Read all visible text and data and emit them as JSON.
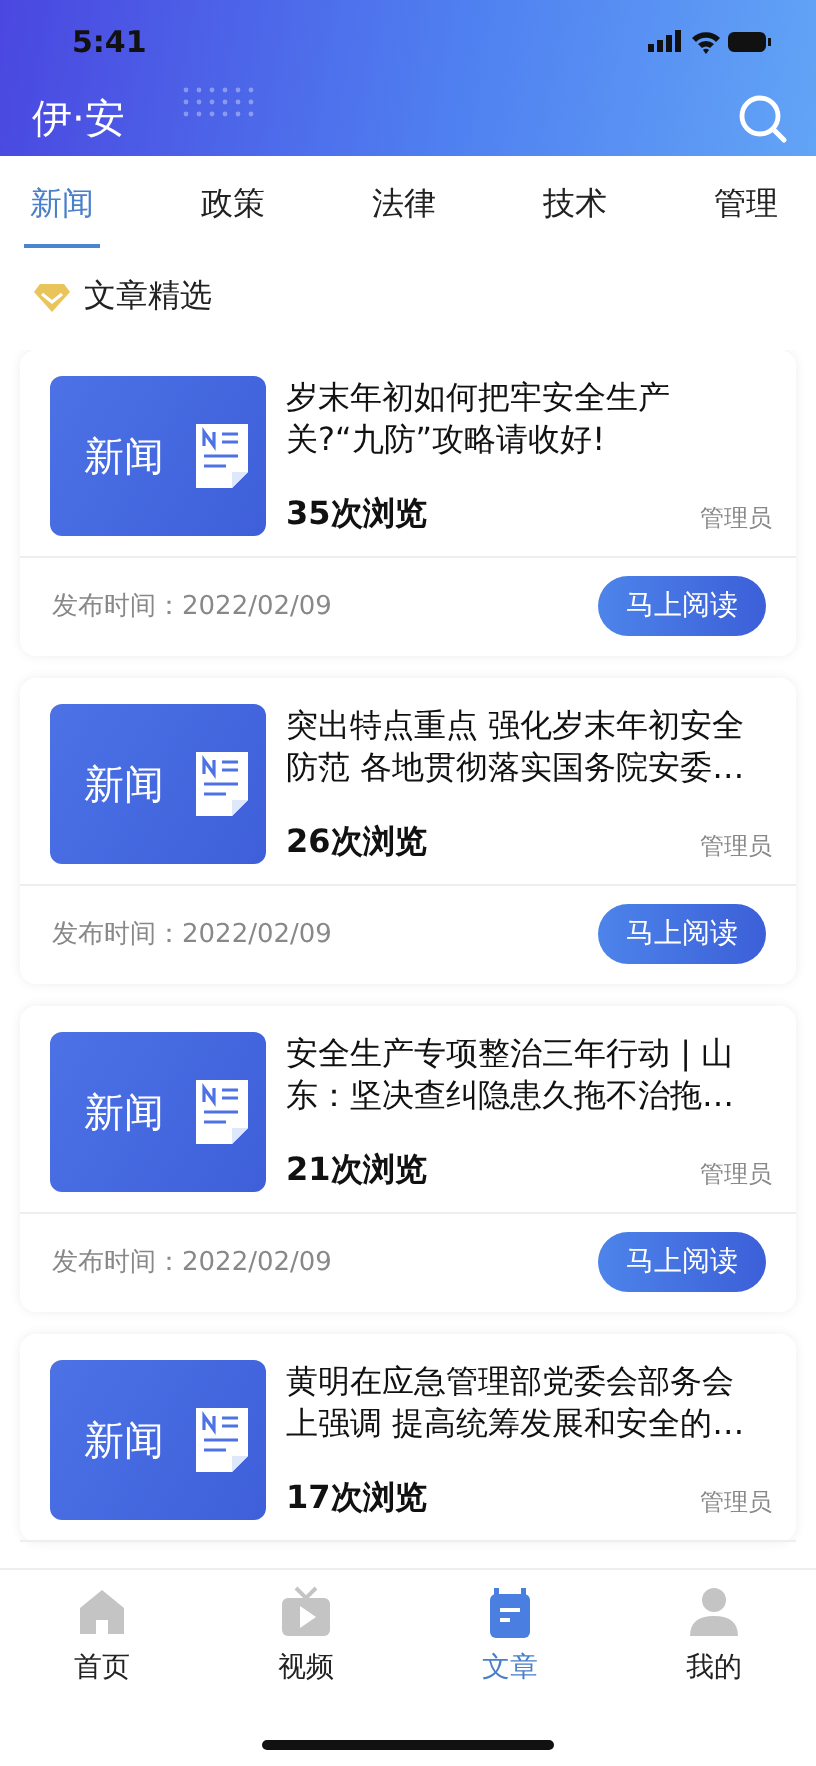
{
  "status_bar": {
    "time": "5:41"
  },
  "header": {
    "title": "伊·安"
  },
  "tabs": [
    {
      "label": "新闻",
      "selected": true
    },
    {
      "label": "政策",
      "selected": false
    },
    {
      "label": "法律",
      "selected": false
    },
    {
      "label": "技术",
      "selected": false
    },
    {
      "label": "管理",
      "selected": false
    }
  ],
  "section": {
    "title": "文章精选"
  },
  "articles": [
    {
      "thumb_label": "新闻",
      "title": "岁末年初如何把牢安全生产关?“九防”攻略请收好!",
      "views": "35次浏览",
      "author": "管理员",
      "date": "发布时间：2022/02/09",
      "button": "马上阅读"
    },
    {
      "thumb_label": "新闻",
      "title": "突出特点重点 强化岁末年初安全防范 各地贯彻落实国务院安委…",
      "views": "26次浏览",
      "author": "管理员",
      "date": "发布时间：2022/02/09",
      "button": "马上阅读"
    },
    {
      "thumb_label": "新闻",
      "title": "安全生产专项整治三年行动 | 山东：坚决查纠隐患久拖不治拖…",
      "views": "21次浏览",
      "author": "管理员",
      "date": "发布时间：2022/02/09",
      "button": "马上阅读"
    },
    {
      "thumb_label": "新闻",
      "title": "黄明在应急管理部党委会部务会上强调 提高统筹发展和安全的…",
      "views": "17次浏览",
      "author": "管理员"
    }
  ],
  "bottom_nav": [
    {
      "kind": "home",
      "label": "首页",
      "selected": false
    },
    {
      "kind": "video",
      "label": "视频",
      "selected": false
    },
    {
      "kind": "article",
      "label": "文章",
      "selected": true
    },
    {
      "kind": "profile",
      "label": "我的",
      "selected": false
    }
  ]
}
